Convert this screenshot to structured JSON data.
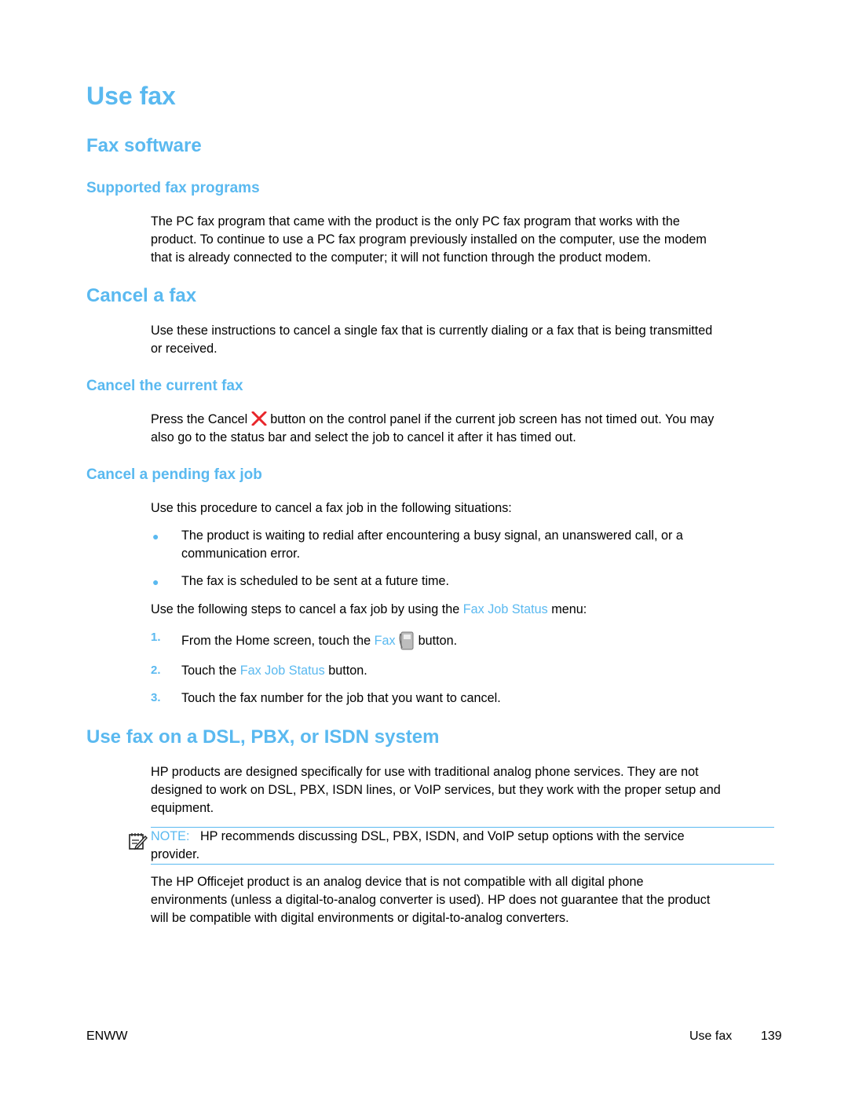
{
  "title": "Use fax",
  "sections": {
    "fax_software": {
      "heading": "Fax software",
      "supported": {
        "heading": "Supported fax programs",
        "lines": [
          "The PC fax program that came with the product is the only PC fax program that works with the",
          "product. To continue to use a PC fax program previously installed on the computer, use the modem",
          "that is already connected to the computer; it will not function through the product modem."
        ]
      }
    },
    "cancel": {
      "heading": "Cancel a fax",
      "lines": [
        "Use these instructions to cancel a single fax that is currently dialing or a fax that is being transmitted",
        "or received."
      ],
      "current": {
        "heading": "Cancel the current fax",
        "line1_before": "Press the Cancel",
        "line1_after": "button on the control panel if the current job screen has not timed out. You may",
        "line2": "also go to the status bar and select the job to cancel it after it has timed out.",
        "icon": "cancel-x-icon"
      },
      "pending": {
        "heading": "Cancel a pending fax job",
        "intro": "Use this procedure to cancel a fax job in the following situations:",
        "bullets": [
          {
            "line1": "The product is waiting to redial after encountering a busy signal, an unanswered call, or a",
            "line2": "communication error."
          },
          {
            "line1": "The fax is scheduled to be sent at a future time."
          }
        ],
        "bullet_glyph": "●",
        "steps_intro_before": "Use the following steps to cancel a fax job by using the",
        "steps_intro_link": "Fax Job Status",
        "steps_intro_after": "menu:",
        "steps": [
          {
            "num": "1.",
            "before": "From the Home screen, touch the",
            "link": "Fax",
            "after": "button.",
            "icon": "fax-icon"
          },
          {
            "num": "2.",
            "before": "Touch the",
            "link": "Fax Job Status",
            "after": "button."
          },
          {
            "num": "3.",
            "before": "Touch the fax number for the job that you want to cancel."
          }
        ]
      }
    },
    "dsl": {
      "heading": "Use fax on a DSL, PBX, or ISDN system",
      "lines": [
        "HP products are designed specifically for use with traditional analog phone services. They are not",
        "designed to work on DSL, PBX, ISDN lines, or VoIP services, but they work with the proper setup and",
        "equipment."
      ],
      "note": {
        "label": "NOTE:",
        "line1": "HP recommends discussing DSL, PBX, ISDN, and VoIP setup options with the service",
        "line2": "provider.",
        "icon": "note-pencil-icon"
      },
      "after_lines": [
        "The HP Officejet product is an analog device that is not compatible with all digital phone",
        "environments (unless a digital-to-analog converter is used). HP does not guarantee that the product",
        "will be compatible with digital environments or digital-to-analog converters."
      ]
    }
  },
  "footer": {
    "left": "ENWW",
    "section": "Use fax",
    "page": "139"
  },
  "colors": {
    "accent": "#5ab9f0",
    "cancel_icon": "#e8262b"
  }
}
